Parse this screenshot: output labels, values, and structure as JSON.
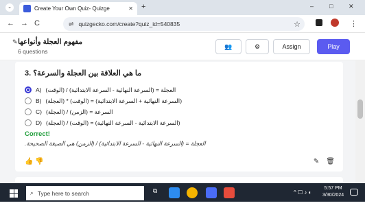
{
  "browser": {
    "tab_title": "Create Your Own Quiz- Quizge",
    "tab_close_icon": "close-icon",
    "new_tab_label": "+",
    "url": "quizgecko.com/create?quiz_id=540835",
    "window_controls": [
      "–",
      "□",
      "✕"
    ]
  },
  "header": {
    "quiz_title": "مفهوم العجلة وأنواعها",
    "question_count": "6 questions",
    "assign_label": "Assign",
    "play_label": "Play",
    "accent_color": "#5b5bf0"
  },
  "question": {
    "number_title": "3. ما هي العلاقة بين العجلة والسرعة؟",
    "options": [
      {
        "letter": "A)",
        "text": "العجلة = (السرعة النهائية - السرعة الابتدائية) / (الوقت)",
        "selected": true
      },
      {
        "letter": "B)",
        "text": "(العجلة) * (الوقت) = (السرعة النهائية + السرعة الابتدائية)",
        "selected": false
      },
      {
        "letter": "C)",
        "text": "السرعة = (الزمن) / (العجلة)",
        "selected": false
      },
      {
        "letter": "D)",
        "text": "(العجلة) / (الوقت) = (السرعة الابتدائية - السرعة النهائية)",
        "selected": false
      }
    ],
    "feedback": "Correct!",
    "feedback_color": "#1f9d3a",
    "explanation": ".العجلة = (السرعة النهائية - السرعة الابتدائية) / (الزمن) هي الصيغة الصحيحة"
  },
  "taskbar": {
    "search_placeholder": "Type here to search",
    "time": "5:57 PM",
    "date": "3/30/2024"
  }
}
